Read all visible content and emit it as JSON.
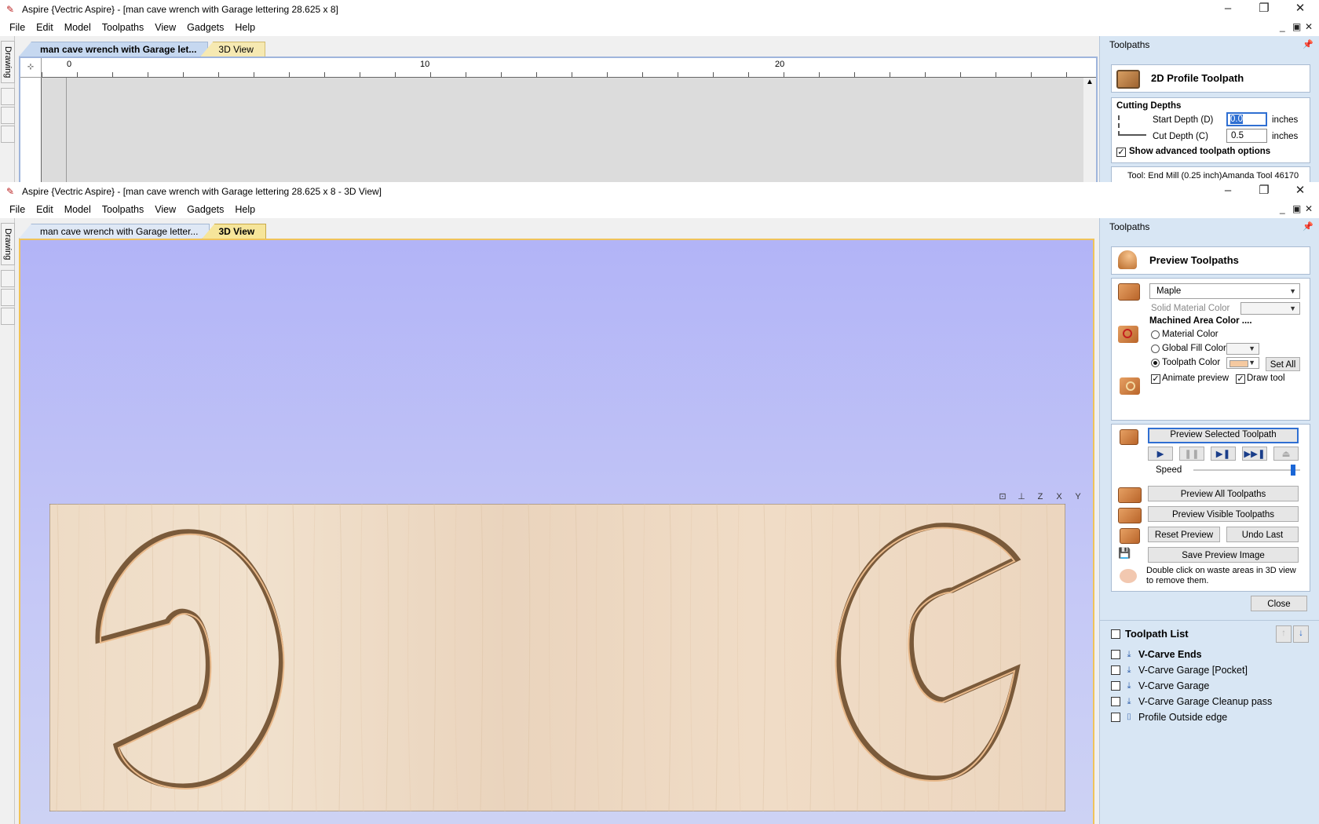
{
  "window1": {
    "title": "Aspire {Vectric Aspire} - [man cave wrench with Garage lettering 28.625 x 8]",
    "menu": [
      "File",
      "Edit",
      "Model",
      "Toolpaths",
      "View",
      "Gadgets",
      "Help"
    ],
    "tabs": [
      "man cave wrench with Garage let...",
      "3D View"
    ],
    "side_tab": "Drawing",
    "ruler": [
      "0",
      "10",
      "20"
    ],
    "panel": {
      "title": "Toolpaths",
      "tool_title": "2D Profile Toolpath",
      "cutting_depths": "Cutting Depths",
      "start_depth_label": "Start Depth (D)",
      "start_depth_value": "0.0",
      "cut_depth_label": "Cut Depth (C)",
      "cut_depth_value": "0.5",
      "unit": "inches",
      "advanced": "Show advanced toolpath options",
      "tool_line": "Tool: End Mill (0.25 inch)Amanda Tool 46170"
    }
  },
  "window2": {
    "title": "Aspire {Vectric Aspire} - [man cave wrench with Garage lettering 28.625 x 8 - 3D View]",
    "menu": [
      "File",
      "Edit",
      "Model",
      "Toolpaths",
      "View",
      "Gadgets",
      "Help"
    ],
    "tabs": [
      "man cave wrench with Garage letter...",
      "3D View"
    ],
    "side_tab": "Drawing",
    "view_tools": [
      "zoom-extents",
      "iso",
      "Z",
      "X",
      "Y"
    ],
    "panel": {
      "title": "Toolpaths",
      "preview_title": "Preview Toolpaths",
      "material": "Maple",
      "solid_material_color": "Solid Material Color",
      "machined_area_color": "Machined Area Color ....",
      "material_color": "Material Color",
      "global_fill_color": "Global Fill Color",
      "toolpath_color": "Toolpath Color",
      "set_all": "Set All",
      "animate_preview": "Animate preview",
      "draw_tool": "Draw tool",
      "preview_selected": "Preview Selected Toolpath",
      "speed": "Speed",
      "speed_value": 0.95,
      "preview_all": "Preview All Toolpaths",
      "preview_visible": "Preview Visible Toolpaths",
      "reset_preview": "Reset Preview",
      "undo_last": "Undo Last",
      "save_preview_image": "Save Preview Image",
      "hint": "Double click on waste areas in 3D view to remove them.",
      "close": "Close",
      "toolpath_list_title": "Toolpath List",
      "toolpaths": [
        {
          "name": "V-Carve Ends",
          "bold": true
        },
        {
          "name": "V-Carve Garage [Pocket]",
          "bold": false
        },
        {
          "name": "V-Carve Garage",
          "bold": false
        },
        {
          "name": "V-Carve Garage Cleanup pass",
          "bold": false
        },
        {
          "name": "Profile Outside edge",
          "bold": false
        }
      ]
    }
  },
  "colors": {
    "view_bg_top": "#b2b4f7",
    "view_bg_bottom": "#cbd0f5",
    "wood": "#eed9c2",
    "panel_bg": "#d8e6f4",
    "accent_blue": "#2f6fd2"
  }
}
